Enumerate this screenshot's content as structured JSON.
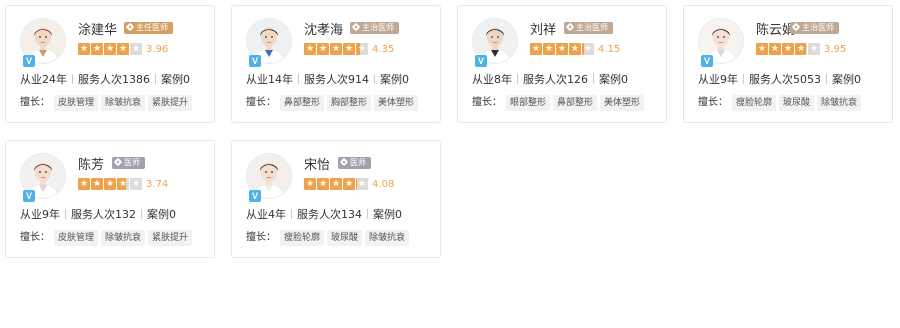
{
  "doctors": [
    {
      "name": "涂建华",
      "title": "主任医师",
      "badge_color": "#d3a064",
      "rating": 3.96,
      "rating_text": "3.96",
      "experience": "从业24年",
      "served": "服务人次1386",
      "cases": "案例0",
      "specialty_label": "擅长：",
      "tags": [
        "皮肤管理",
        "除皱抗衰",
        "紧肤提升"
      ],
      "verified": "V",
      "icon": "doctor-avatar"
    },
    {
      "name": "沈孝海",
      "title": "主治医师",
      "badge_color": "#bfa894",
      "rating": 4.35,
      "rating_text": "4.35",
      "experience": "从业14年",
      "served": "服务人次914",
      "cases": "案例0",
      "specialty_label": "擅长：",
      "tags": [
        "鼻部整形",
        "胸部整形",
        "美体塑形"
      ],
      "verified": "V",
      "icon": "doctor-avatar"
    },
    {
      "name": "刘祥",
      "title": "主治医师",
      "badge_color": "#bfa894",
      "rating": 4.15,
      "rating_text": "4.15",
      "experience": "从业8年",
      "served": "服务人次126",
      "cases": "案例0",
      "specialty_label": "擅长：",
      "tags": [
        "眼部整形",
        "鼻部整形",
        "美体塑形"
      ],
      "verified": "V",
      "icon": "doctor-avatar"
    },
    {
      "name": "陈云娟",
      "title": "主治医师",
      "badge_color": "#bfa894",
      "rating": 3.95,
      "rating_text": "3.95",
      "experience": "从业9年",
      "served": "服务人次5053",
      "cases": "案例0",
      "specialty_label": "擅长：",
      "tags": [
        "瘦脸轮廓",
        "玻尿酸",
        "除皱抗衰"
      ],
      "verified": "V",
      "icon": "doctor-avatar"
    },
    {
      "name": "陈芳",
      "title": "医师",
      "badge_color": "#a0a0ae",
      "rating": 3.74,
      "rating_text": "3.74",
      "experience": "从业9年",
      "served": "服务人次132",
      "cases": "案例0",
      "specialty_label": "擅长：",
      "tags": [
        "皮肤管理",
        "除皱抗衰",
        "紧肤提升"
      ],
      "verified": "V",
      "icon": "doctor-avatar"
    },
    {
      "name": "宋怡",
      "title": "医师",
      "badge_color": "#a0a0ae",
      "rating": 4.08,
      "rating_text": "4.08",
      "experience": "从业4年",
      "served": "服务人次134",
      "cases": "案例0",
      "specialty_label": "擅长：",
      "tags": [
        "瘦脸轮廓",
        "玻尿酸",
        "除皱抗衰"
      ],
      "verified": "V",
      "icon": "doctor-avatar"
    }
  ],
  "colors": {
    "star_filled": "#f0a24a",
    "star_empty": "#dcdcdc",
    "verified": "#4fb3e8"
  }
}
